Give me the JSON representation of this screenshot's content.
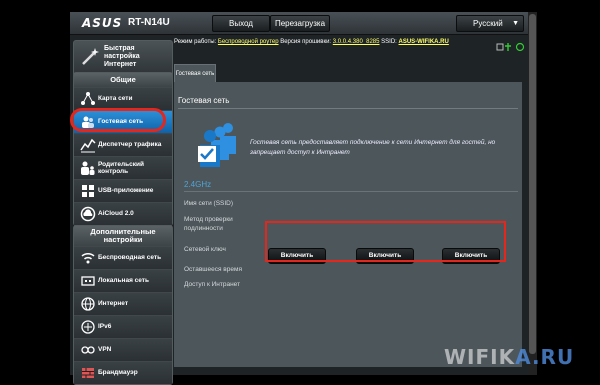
{
  "header": {
    "brand": "ASUS",
    "model": "RT-N14U",
    "logout_label": "Выход",
    "reboot_label": "Перезагрузка",
    "language": "Русский"
  },
  "status": {
    "mode_label": "Режим работы:",
    "mode_value": "Беспроводной роутер",
    "firmware_label": "Версия прошивки:",
    "firmware_value": "3.0.0.4.380_8285",
    "ssid_label": "SSID:",
    "ssid_value": "ASUS-WIFIKA.RU"
  },
  "sidebar": {
    "quick_setup": "Быстрая настройка Интернет",
    "general_header": "Общие",
    "general_items": [
      {
        "label": "Карта сети",
        "icon": "network-map-icon"
      },
      {
        "label": "Гостевая сеть",
        "icon": "guest-network-icon"
      },
      {
        "label": "Диспетчер трафика",
        "icon": "traffic-manager-icon"
      },
      {
        "label": "Родительский контроль",
        "icon": "parental-control-icon"
      },
      {
        "label": "USB-приложение",
        "icon": "usb-app-icon"
      },
      {
        "label": "AiCloud 2.0",
        "icon": "aicloud-icon"
      }
    ],
    "advanced_header": "Дополнительные настройки",
    "advanced_items": [
      {
        "label": "Беспроводная сеть",
        "icon": "wireless-icon"
      },
      {
        "label": "Локальная сеть",
        "icon": "lan-icon"
      },
      {
        "label": "Интернет",
        "icon": "internet-icon"
      },
      {
        "label": "IPv6",
        "icon": "ipv6-icon"
      },
      {
        "label": "VPN",
        "icon": "vpn-icon"
      },
      {
        "label": "Брандмауэр",
        "icon": "firewall-icon"
      }
    ]
  },
  "main": {
    "tab_label": "Гостевая сеть",
    "title": "Гостевая сеть",
    "description": "Гостевая сеть предоставляет подключение к сети Интернет для гостей, но запрещает доступ к Интранет",
    "band": "2.4GHz",
    "fields": [
      "Имя сети (SSID)",
      "Метод проверки подлинности",
      "Сетевой ключ",
      "Оставшееся время",
      "Доступ к Интранет"
    ],
    "enable_buttons": [
      "Включить",
      "Включить",
      "Включить"
    ]
  },
  "watermark": {
    "part1": "WIFIK",
    "part2": "A.RU"
  },
  "colors": {
    "accent_blue": "#1a78c8",
    "highlight_red": "#e5261c",
    "band_text": "#4fa4d6"
  }
}
